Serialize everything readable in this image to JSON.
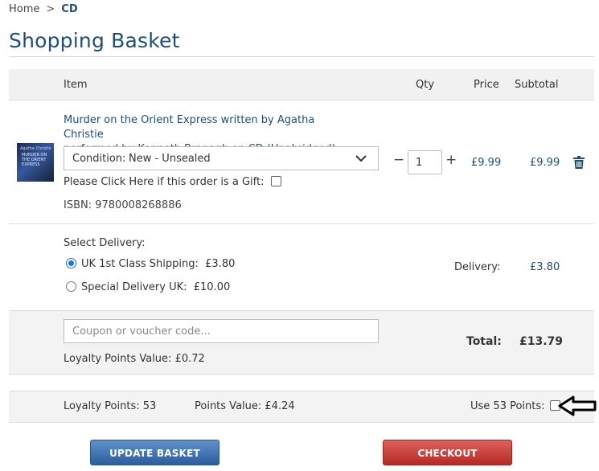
{
  "breadcrumb": {
    "home": "Home",
    "separator": ">",
    "current": "CD"
  },
  "page": {
    "title": "Shopping Basket"
  },
  "table_headers": {
    "item": "Item",
    "qty": "Qty",
    "price": "Price",
    "subtotal": "Subtotal"
  },
  "item": {
    "cover_author": "Agatha Christie",
    "cover_title": "MURDER ON THE ORIENT EXPRESS",
    "title_line1": "Murder on the Orient Express written by Agatha Christie",
    "title_line2": "performed by Kenneth Branagh on CD (Unabridged)",
    "condition_label": "Condition:",
    "condition_value": "New - Unsealed",
    "gift_label": "Please Click Here if this order is a Gift:",
    "isbn": "ISBN: 9780008268886",
    "qty_minus": "−",
    "qty_value": "1",
    "qty_plus": "+",
    "price": "£9.99",
    "subtotal": "£9.99"
  },
  "delivery": {
    "title": "Select Delivery:",
    "options": [
      {
        "name": "UK 1st Class Shipping:",
        "price": "£3.80",
        "selected": true
      },
      {
        "name": "Special Delivery UK:",
        "price": "£10.00",
        "selected": false
      }
    ],
    "label": "Delivery:",
    "value": "£3.80"
  },
  "coupon": {
    "placeholder": "Coupon or voucher code..."
  },
  "loyalty_value": {
    "label": "Loyalty Points Value:",
    "value": "£0.72"
  },
  "total": {
    "label": "Total:",
    "value": "£13.79"
  },
  "points": {
    "loyalty_label": "Loyalty Points:",
    "loyalty_value": "53",
    "points_value_label": "Points Value:",
    "points_value": "£4.24",
    "use_label": "Use 53 Points:"
  },
  "buttons": {
    "update": "UPDATE BASKET",
    "checkout": "CHECKOUT"
  },
  "colors": {
    "brand_blue": "#1f4e79",
    "update_btn": "#3a6db0",
    "checkout_btn": "#c8332d",
    "radio_selected": "#1a73e8"
  }
}
